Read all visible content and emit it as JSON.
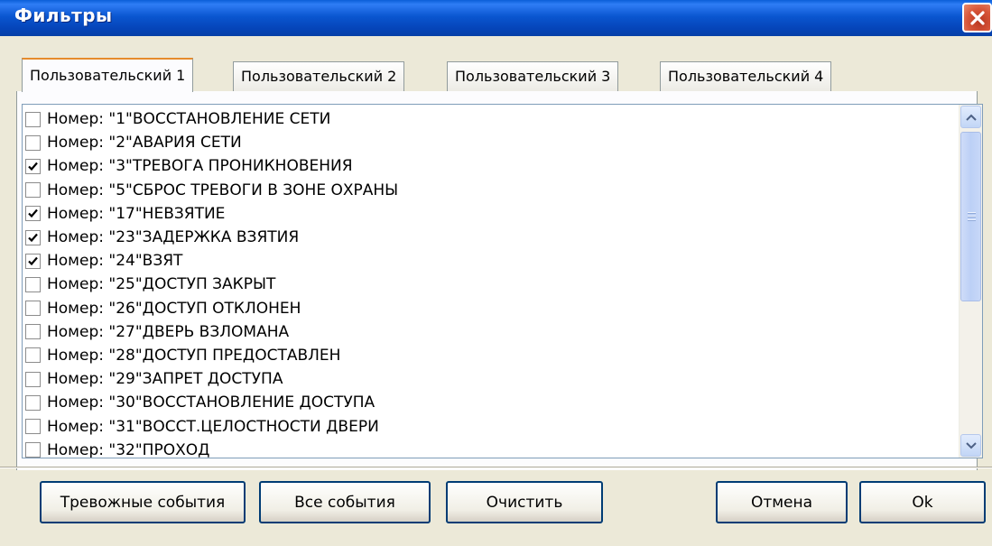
{
  "window": {
    "title": "Фильтры"
  },
  "tabs": [
    {
      "label": "Пользовательский 1",
      "active": true
    },
    {
      "label": "Пользовательский 2",
      "active": false
    },
    {
      "label": "Пользовательский 3",
      "active": false
    },
    {
      "label": "Пользовательский 4",
      "active": false
    }
  ],
  "events": [
    {
      "num": "Номер: \"1\"",
      "name": "ВОССТАНОВЛЕНИЕ СЕТИ",
      "checked": false
    },
    {
      "num": "Номер: \"2\"",
      "name": "АВАРИЯ СЕТИ",
      "checked": false
    },
    {
      "num": "Номер: \"3\"",
      "name": "ТРЕВОГА ПРОНИКНОВЕНИЯ",
      "checked": true
    },
    {
      "num": "Номер: \"5\"",
      "name": "СБРОС ТРЕВОГИ В ЗОНЕ ОХРАНЫ",
      "checked": false
    },
    {
      "num": "Номер: \"17\"",
      "name": "НЕВЗЯТИЕ",
      "checked": true
    },
    {
      "num": "Номер: \"23\"",
      "name": "ЗАДЕРЖКА ВЗЯТИЯ",
      "checked": true
    },
    {
      "num": "Номер: \"24\"",
      "name": "ВЗЯТ",
      "checked": true
    },
    {
      "num": "Номер: \"25\"",
      "name": "ДОСТУП ЗАКРЫТ",
      "checked": false
    },
    {
      "num": "Номер: \"26\"",
      "name": "ДОСТУП ОТКЛОНЕН",
      "checked": false
    },
    {
      "num": "Номер: \"27\"",
      "name": "ДВЕРЬ ВЗЛОМАНА",
      "checked": false
    },
    {
      "num": "Номер: \"28\"",
      "name": "ДОСТУП ПРЕДОСТАВЛЕН",
      "checked": false
    },
    {
      "num": "Номер: \"29\"",
      "name": "ЗАПРЕТ ДОСТУПА",
      "checked": false
    },
    {
      "num": "Номер: \"30\"",
      "name": "ВОССТАНОВЛЕНИЕ ДОСТУПА",
      "checked": false
    },
    {
      "num": "Номер: \"31\"",
      "name": "ВОССТ.ЦЕЛОСТНОСТИ ДВЕРИ",
      "checked": false
    },
    {
      "num": "Номер: \"32\"",
      "name": "ПРОХОД",
      "checked": false
    }
  ],
  "buttons": {
    "alarm_events": "Тревожные события",
    "all_events": "Все события",
    "clear": "Очистить",
    "cancel": "Отмена",
    "ok": "Ok"
  },
  "icons": {
    "close": "close-icon",
    "check": "check-icon",
    "scroll_up": "chevron-up-icon",
    "scroll_down": "chevron-down-icon"
  },
  "colors": {
    "titlebar": "#0a56d0",
    "dialog_bg": "#ece9d8",
    "close_red": "#d9573a",
    "active_tab_accent": "#e68b2c"
  }
}
